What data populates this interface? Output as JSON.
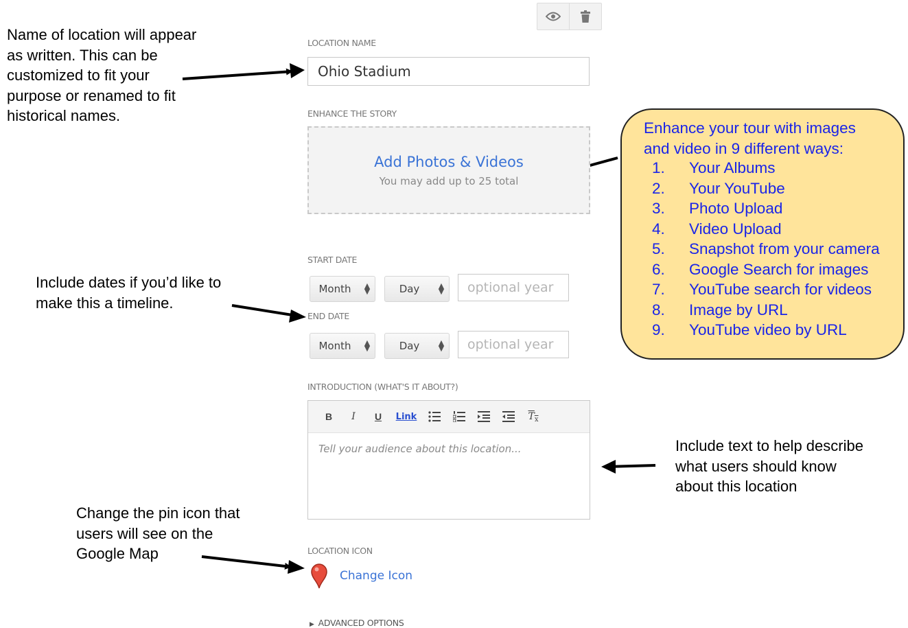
{
  "annotations": {
    "name_note": "Name of location will appear\nas written. This can be\ncustomized to fit your\npurpose or renamed to fit\nhistorical names.",
    "dates_note": "Include dates if you’d like to\nmake this a timeline.",
    "text_note": "Include text to help describe\nwhat users should know\nabout this location",
    "icon_note": "Change the pin icon that\nusers will see on the\nGoogle Map"
  },
  "callout": {
    "heading": "Enhance your tour with images\nand video in 9 different ways:",
    "items": [
      {
        "num": "1.",
        "text": "Your Albums"
      },
      {
        "num": "2.",
        "text": "Your YouTube"
      },
      {
        "num": "3.",
        "text": "Photo Upload"
      },
      {
        "num": "4.",
        "text": "Video Upload"
      },
      {
        "num": "5.",
        "text": "Snapshot from your camera"
      },
      {
        "num": "6.",
        "text": "Google Search for images"
      },
      {
        "num": "7.",
        "text": "YouTube search for videos"
      },
      {
        "num": "8.",
        "text": "Image by URL"
      },
      {
        "num": "9.",
        "text": "YouTube video by URL"
      }
    ]
  },
  "toolbar": {
    "preview_icon": "eye-icon",
    "delete_icon": "trash-icon"
  },
  "form": {
    "location_name_label": "LOCATION NAME",
    "location_name_value": "Ohio Stadium",
    "enhance_label": "ENHANCE THE STORY",
    "add_media_link": "Add Photos & Videos",
    "add_media_hint": "You may add up to 25 total",
    "start_date_label": "START DATE",
    "end_date_label": "END DATE",
    "month_select": "Month",
    "day_select": "Day",
    "year_placeholder": "optional year",
    "intro_label": "INTRODUCTION (WHAT'S IT ABOUT?)",
    "editor_buttons": {
      "bold": "B",
      "italic": "I",
      "underline": "U",
      "link": "Link",
      "clear": "T"
    },
    "intro_placeholder": "Tell your audience about this location...",
    "icon_label": "LOCATION ICON",
    "change_icon_link": "Change Icon",
    "advanced_options": "ADVANCED OPTIONS"
  },
  "colors": {
    "callout_bg": "#ffe49b",
    "callout_text": "#1a24e8",
    "link": "#3a73d6"
  }
}
